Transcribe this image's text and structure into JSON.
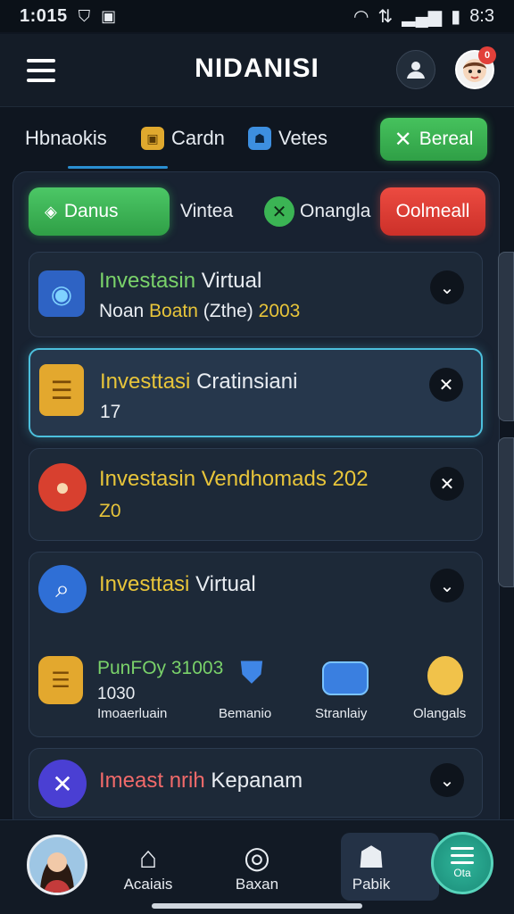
{
  "status": {
    "time": "1:015",
    "right_text": "8:3"
  },
  "appbar": {
    "title": "NIDANISI",
    "notif_badge": "0"
  },
  "tabs": [
    {
      "label": "Hbnaokis"
    },
    {
      "label": "Cardn"
    },
    {
      "label": "Vetes"
    }
  ],
  "refresh_button": {
    "label": "Bereal"
  },
  "filters": [
    {
      "label": "Danus"
    },
    {
      "label": "Vintea"
    },
    {
      "label": "Onangla"
    },
    {
      "label": "Oolmeall"
    }
  ],
  "cards": [
    {
      "title_a": "Investasin",
      "title_b": "Virtual",
      "sub_a": "Noan",
      "sub_b": "Boatn",
      "sub_c": "(Zthe)",
      "sub_d": "2003"
    },
    {
      "title_a": "Investtasi",
      "title_b": "Cratinsiani",
      "sub": "17"
    },
    {
      "title_a": "Investasin",
      "title_b": "Vendhomads 202",
      "sub": "Z0"
    },
    {
      "title_a": "Investtasi",
      "title_b": "Virtual",
      "promo": "PunFOy 31003",
      "promo_sub": "1030",
      "items": [
        {
          "label": "Imoaerluain"
        },
        {
          "label": "Bemanio"
        },
        {
          "label": "Stranlaiy"
        },
        {
          "label": "Olangals"
        }
      ]
    },
    {
      "title_a": "Imeast nrih",
      "title_b": "Kepanam"
    }
  ],
  "bottomnav": [
    {
      "label": "Acaiais"
    },
    {
      "label": "Baxan"
    },
    {
      "label": "Pabik"
    },
    {
      "label": "Ota"
    }
  ],
  "colors": {
    "accent_green": "#3bb454",
    "accent_red": "#e2403a",
    "highlight_yellow": "#e8c53a",
    "selected_border": "#4cc0dd"
  }
}
